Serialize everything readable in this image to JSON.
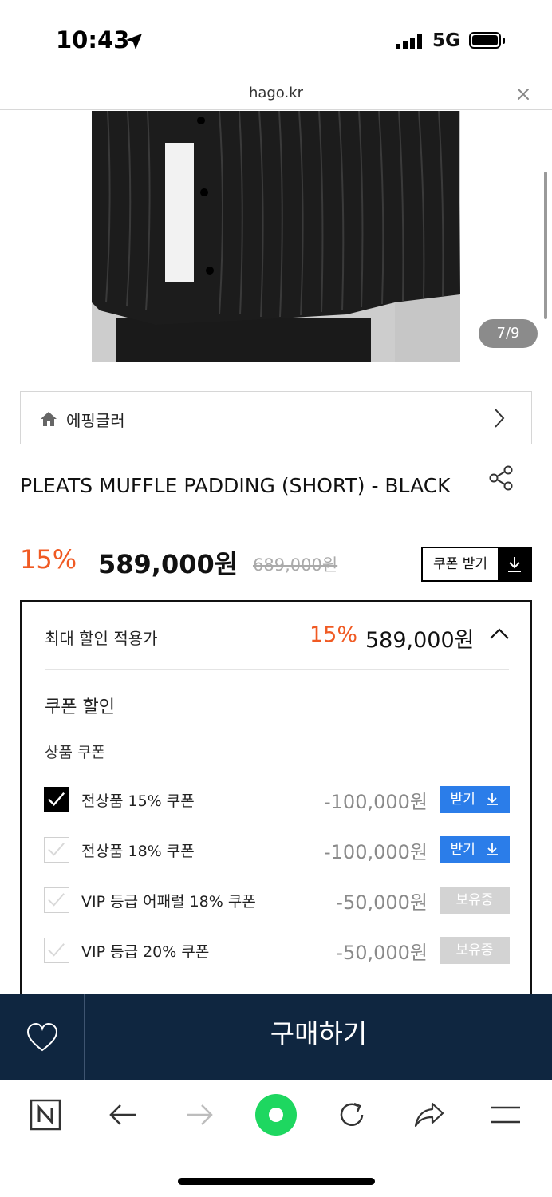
{
  "status_bar": {
    "time": "10:43",
    "network": "5G"
  },
  "browser": {
    "url": "hago.kr"
  },
  "gallery": {
    "counter": "7/9"
  },
  "brand": {
    "name": "에핑글러"
  },
  "product": {
    "title": "PLEATS MUFFLE PADDING (SHORT) - BLACK",
    "discount_rate": "15%",
    "price": "589,000원",
    "original_price": "689,000원",
    "coupon_button": "쿠폰 받기"
  },
  "discount": {
    "max_label": "최대 할인 적용가",
    "max_rate": "15%",
    "max_price": "589,000원",
    "coupon_section": "쿠폰 할인",
    "product_coupon_label": "상품 쿠폰",
    "coupons": [
      {
        "name": "전상품 15% 쿠폰",
        "amount": "-100,000원",
        "button": "받기",
        "checked": true,
        "state": "download"
      },
      {
        "name": "전상품 18% 쿠폰",
        "amount": "-100,000원",
        "button": "받기",
        "checked": false,
        "state": "download"
      },
      {
        "name": "VIP 등급 어패럴 18% 쿠폰",
        "amount": "-50,000원",
        "button": "보유중",
        "checked": false,
        "state": "owned"
      },
      {
        "name": "VIP 등급 20% 쿠폰",
        "amount": "-50,000원",
        "button": "보유중",
        "checked": false,
        "state": "owned"
      }
    ]
  },
  "buy_bar": {
    "buy_label": "구매하기"
  },
  "colors": {
    "accent": "#f05a23",
    "buy_bar": "#0f2640",
    "coupon_blue": "#2b7de9",
    "green_home": "#1ed760"
  },
  "toolbar_icons": [
    "naver-icon",
    "back-arrow-icon",
    "forward-arrow-icon",
    "green-home-icon",
    "refresh-icon",
    "share-icon",
    "menu-icon"
  ]
}
